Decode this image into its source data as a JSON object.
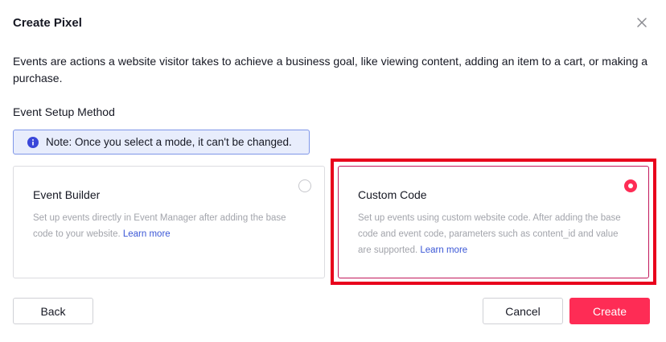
{
  "dialog": {
    "title": "Create Pixel",
    "description": "Events are actions a website visitor takes to achieve a business goal, like viewing content, adding an item to a cart, or making a purchase."
  },
  "setup": {
    "label": "Event Setup Method",
    "note": "Note: Once you select a mode, it can't be changed."
  },
  "options": [
    {
      "title": "Event Builder",
      "text": "Set up events directly in Event Manager after adding the base code to your website.",
      "link": "Learn more",
      "selected": false
    },
    {
      "title": "Custom Code",
      "text": "Set up events using custom website code. After adding the base code and event code, parameters such as content_id and value are supported.",
      "link": "Learn more",
      "selected": true
    }
  ],
  "footer": {
    "back_label": "Back",
    "cancel_label": "Cancel",
    "create_label": "Create"
  },
  "colors": {
    "accent": "#fe2c55",
    "note_bg": "#e8edfc",
    "link": "#3b57d6",
    "highlight": "#e8001c"
  }
}
